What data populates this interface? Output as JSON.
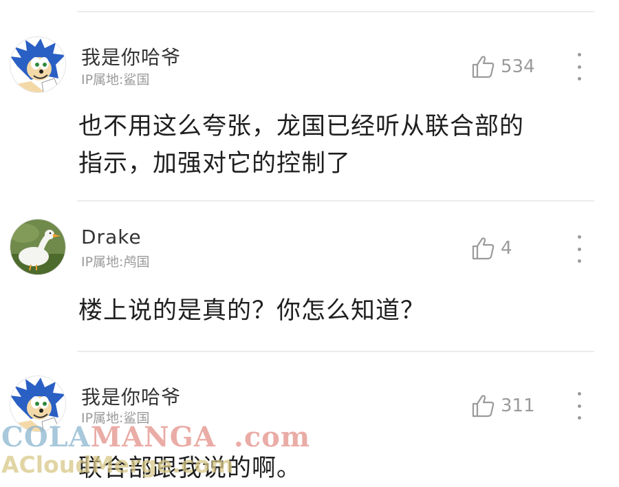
{
  "comments": [
    {
      "username": "我是你哈爷",
      "ip": "IP属地:鲨国",
      "likes": "534",
      "text_lines": [
        "也不用这么夸张，龙国已经听从联合部的",
        "指示，加强对它的控制了"
      ],
      "avatar": "blue-hedgehog-avatar"
    },
    {
      "username": "Drake",
      "ip": "IP属地:鸬国",
      "likes": "4",
      "text_lines": [
        "楼上说的是真的？你怎么知道？"
      ],
      "avatar": "white-duck-avatar"
    },
    {
      "username": "我是你哈爷",
      "ip": "IP属地:鲨国",
      "likes": "311",
      "text_lines": [
        "联合部跟我说的啊。"
      ],
      "avatar": "blue-hedgehog-avatar"
    }
  ],
  "watermark": {
    "part1": "COLA",
    "part2": "MANGA",
    "part3": ".com",
    "line2": "ACloudMerge.com"
  },
  "colors": {
    "meta_gray": "#9a9a9a",
    "body_text": "#1f1f1f",
    "divider": "#ececec",
    "avatar_blue": "#2a5fc4"
  },
  "icons": [
    "thumbs-up-icon",
    "more-vertical-icon"
  ]
}
